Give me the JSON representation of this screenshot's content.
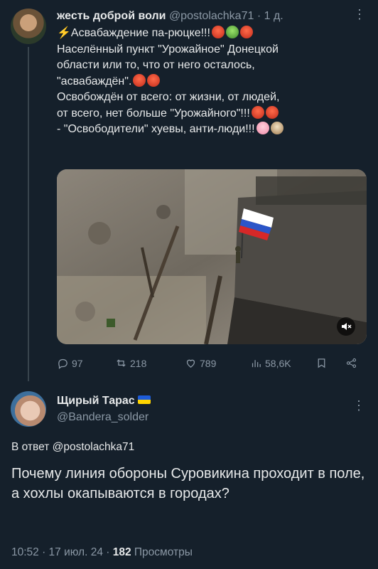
{
  "tweet1": {
    "author_name": "жесть доброй воли",
    "handle": "@postolachka71",
    "sep": "·",
    "time": "1 д.",
    "more": "⋮",
    "line1": "Асвабаждение па-рюцке!!!",
    "line2": " Населённый пункт \"Урожайное\" Донецкой",
    "line3": "области  или то, что от него осталось,",
    "line4": "\"асвабаждён\".",
    "line5": " Освобождён от всего: от жизни, от людей,",
    "line6": "от всего, нет больше \"Урожайного\"!!!",
    "line7": " - \"Освободители\" хуевы, анти-люди!!!",
    "actions": {
      "replies": "97",
      "retweets": "218",
      "likes": "789",
      "views": "58,6K"
    },
    "media": {
      "mute_icon": "speaker-mute-icon"
    }
  },
  "tweet2": {
    "author_name": "Щирый Тарас",
    "handle": "@Bandera_solder",
    "more": "⋮",
    "reply_to": "В ответ @postolachka71",
    "text": "Почему линия обороны Суровикина проходит в поле, а хохлы окапываются в городах?",
    "meta_time": "10:52 · 17 июл. 24 · ",
    "views_count": "182",
    "views_label": " Просмотры"
  },
  "colors": {
    "background": "#15202b",
    "text": "#e7e9ea",
    "muted": "#8b98a5"
  }
}
